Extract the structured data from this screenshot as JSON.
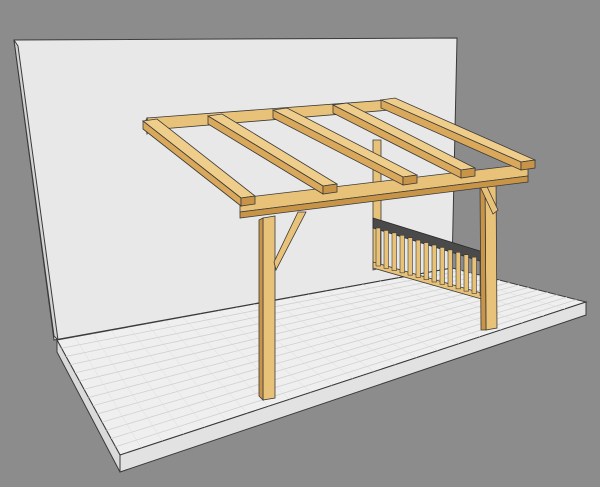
{
  "scene": {
    "subject": "timber-pergola-3d-render",
    "colors": {
      "background": "#8c8c8c",
      "wall": "#e6e6e6",
      "wall_side": "#d4d4d4",
      "deck": "#ececec",
      "deck_lines": "#d2d2d2",
      "deck_edge": "#dcdcdc",
      "timber": "#e9c27a",
      "timber_dark": "#c89447",
      "railing_cap": "#4a4a4a",
      "outline": "#3a3a3a"
    }
  }
}
